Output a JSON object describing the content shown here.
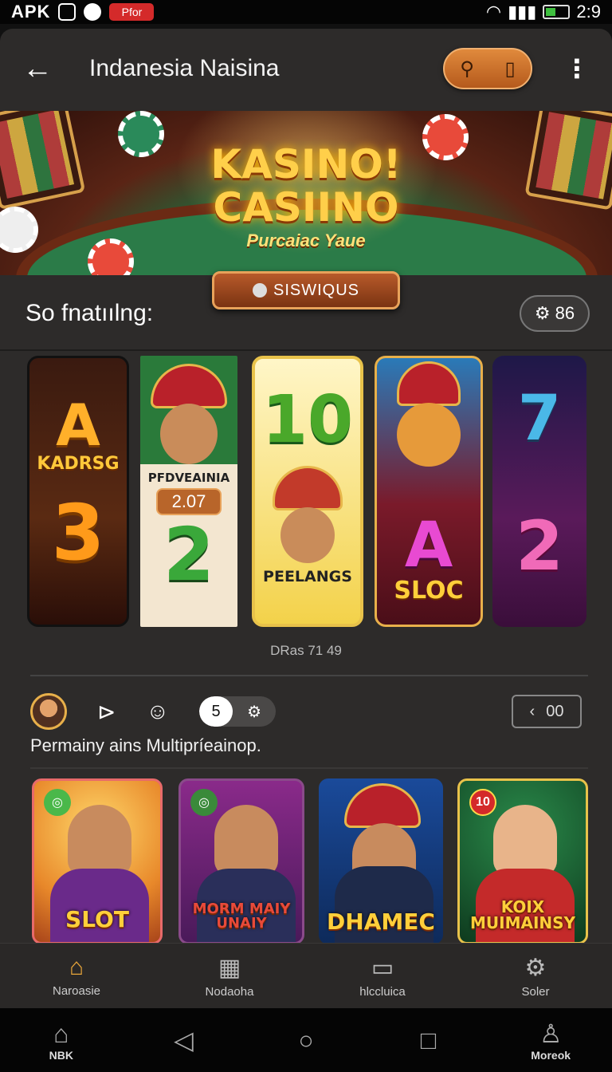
{
  "status_bar": {
    "carrier": "APK",
    "time": "2:9",
    "badge_text": "Pfor"
  },
  "app_bar": {
    "title": "Indanesia Naisina"
  },
  "banner": {
    "title_line1": "KASINO!",
    "title_line2": "CASIINO",
    "subtitle": "Purcaiac Yaue",
    "cta_label": "SISWIQUS"
  },
  "section1": {
    "heading": "So fnatıılng:",
    "count": "86"
  },
  "games": [
    {
      "top": "A",
      "name": "KADRSG",
      "number": "3"
    },
    {
      "name": "PFDVEAINIA",
      "value": "2.07",
      "number": "2"
    },
    {
      "number": "10",
      "name": "PEELANGS"
    },
    {
      "letter": "A",
      "name": "SLOC"
    },
    {
      "top": "7",
      "number": "2"
    }
  ],
  "carousel_caption": "DRas 71 49",
  "section2": {
    "toggle_value": "5",
    "pager_value": "00",
    "description": "Permainy ains Multipríeainop."
  },
  "games2": [
    {
      "name": "SLOT"
    },
    {
      "name": "MORM MAIY UNAIY"
    },
    {
      "name": "DHAMEC"
    },
    {
      "name": "KOIX MUIMAINSY",
      "badge": "10"
    }
  ],
  "bottom_nav": [
    {
      "label": "Naroasie",
      "icon": "home-icon"
    },
    {
      "label": "Nodaoha",
      "icon": "grid-icon"
    },
    {
      "label": "hlccluica",
      "icon": "chat-icon"
    },
    {
      "label": "Soler",
      "icon": "gear-icon"
    }
  ],
  "system_nav": {
    "left_label": "NBK",
    "right_label": "Moreok"
  },
  "colors": {
    "accent": "#e8a63a",
    "background": "#2d2b2a",
    "banner_gold": "#ffcf4a"
  }
}
